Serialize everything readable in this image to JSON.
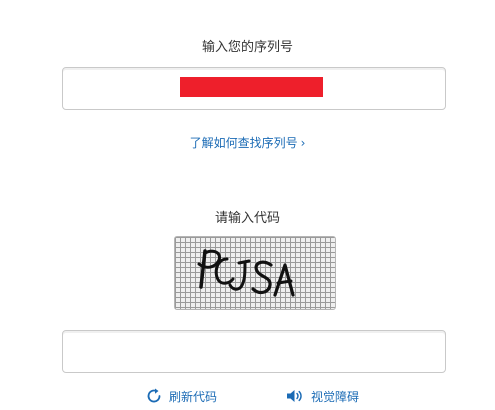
{
  "serial": {
    "label": "输入您的序列号",
    "value": "",
    "redaction_color": "#ee1f2b"
  },
  "help_link": {
    "label": "了解如何查找序列号",
    "chevron": "›"
  },
  "captcha": {
    "label": "请输入代码",
    "image_text": "PCJSA"
  },
  "code_input": {
    "value": "",
    "placeholder": ""
  },
  "actions": {
    "refresh_label": "刷新代码",
    "refresh_icon": "refresh-icon",
    "audio_label": "视觉障碍",
    "audio_icon": "speaker-icon"
  },
  "colors": {
    "link": "#1b6bb5",
    "border": "#c9c9c9",
    "text": "#333333"
  }
}
